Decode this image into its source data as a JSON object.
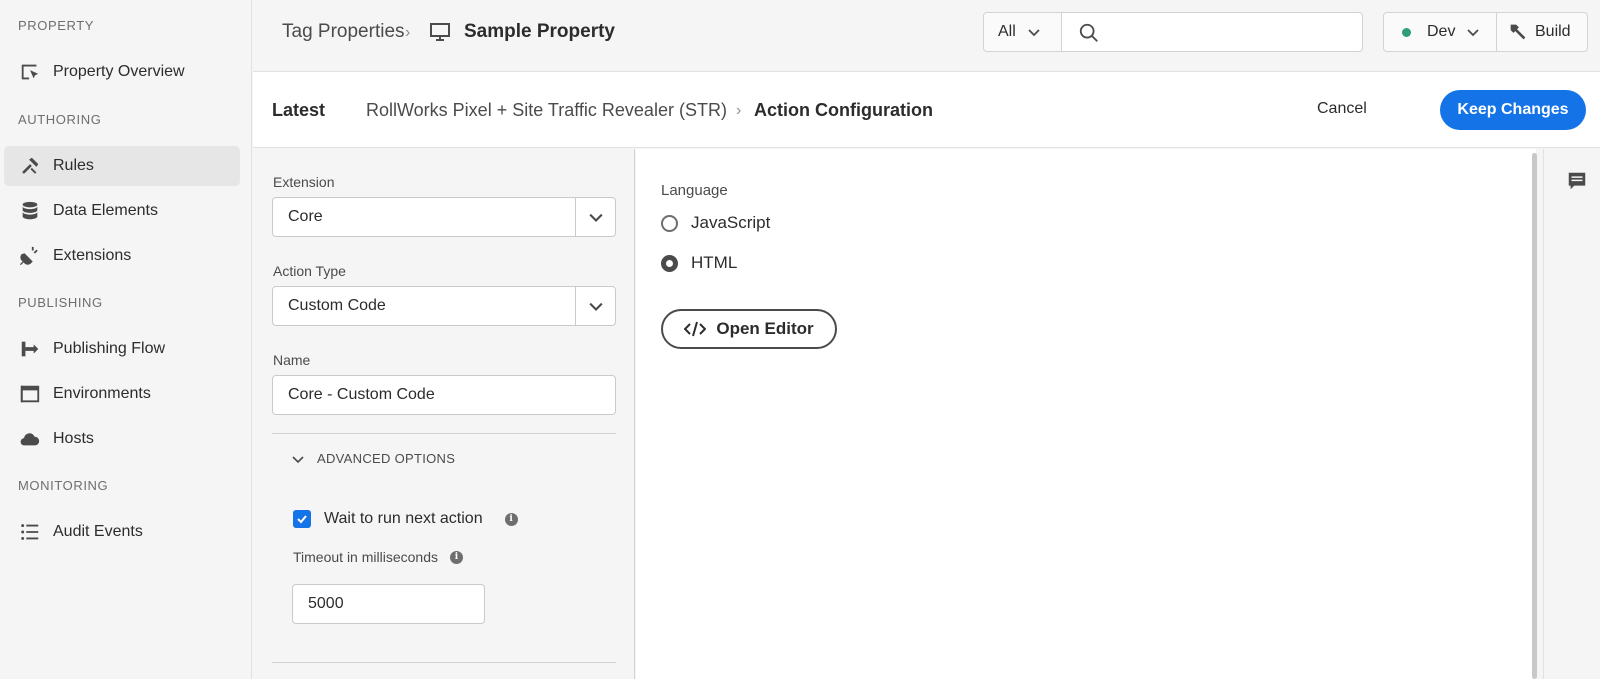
{
  "sidebar": {
    "sections": {
      "property": "PROPERTY",
      "authoring": "AUTHORING",
      "publishing": "PUBLISHING",
      "monitoring": "MONITORING"
    },
    "items": {
      "property_overview": "Property Overview",
      "rules": "Rules",
      "data_elements": "Data Elements",
      "extensions": "Extensions",
      "publishing_flow": "Publishing Flow",
      "environments": "Environments",
      "hosts": "Hosts",
      "audit_events": "Audit Events"
    },
    "active": "rules"
  },
  "topbar": {
    "breadcrumb_parent": "Tag Properties",
    "breadcrumb_current": "Sample Property",
    "search_scope": "All",
    "search_value": "",
    "environment": "Dev",
    "environment_status_color": "#2d9d78",
    "build_label": "Build"
  },
  "subheader": {
    "library": "Latest",
    "rule_name": "RollWorks Pixel + Site Traffic Revealer (STR)",
    "page": "Action Configuration",
    "cancel_label": "Cancel",
    "keep_label": "Keep Changes",
    "accent_color": "#1473e6"
  },
  "form": {
    "extension_label": "Extension",
    "extension_value": "Core",
    "action_type_label": "Action Type",
    "action_type_value": "Custom Code",
    "name_label": "Name",
    "name_value": "Core - Custom Code",
    "advanced_label": "ADVANCED OPTIONS",
    "wait_label": "Wait to run next action",
    "wait_checked": true,
    "timeout_label": "Timeout in milliseconds",
    "timeout_value": "5000"
  },
  "config": {
    "language_label": "Language",
    "options": [
      "JavaScript",
      "HTML"
    ],
    "selected": "HTML",
    "open_editor_label": "Open Editor"
  }
}
